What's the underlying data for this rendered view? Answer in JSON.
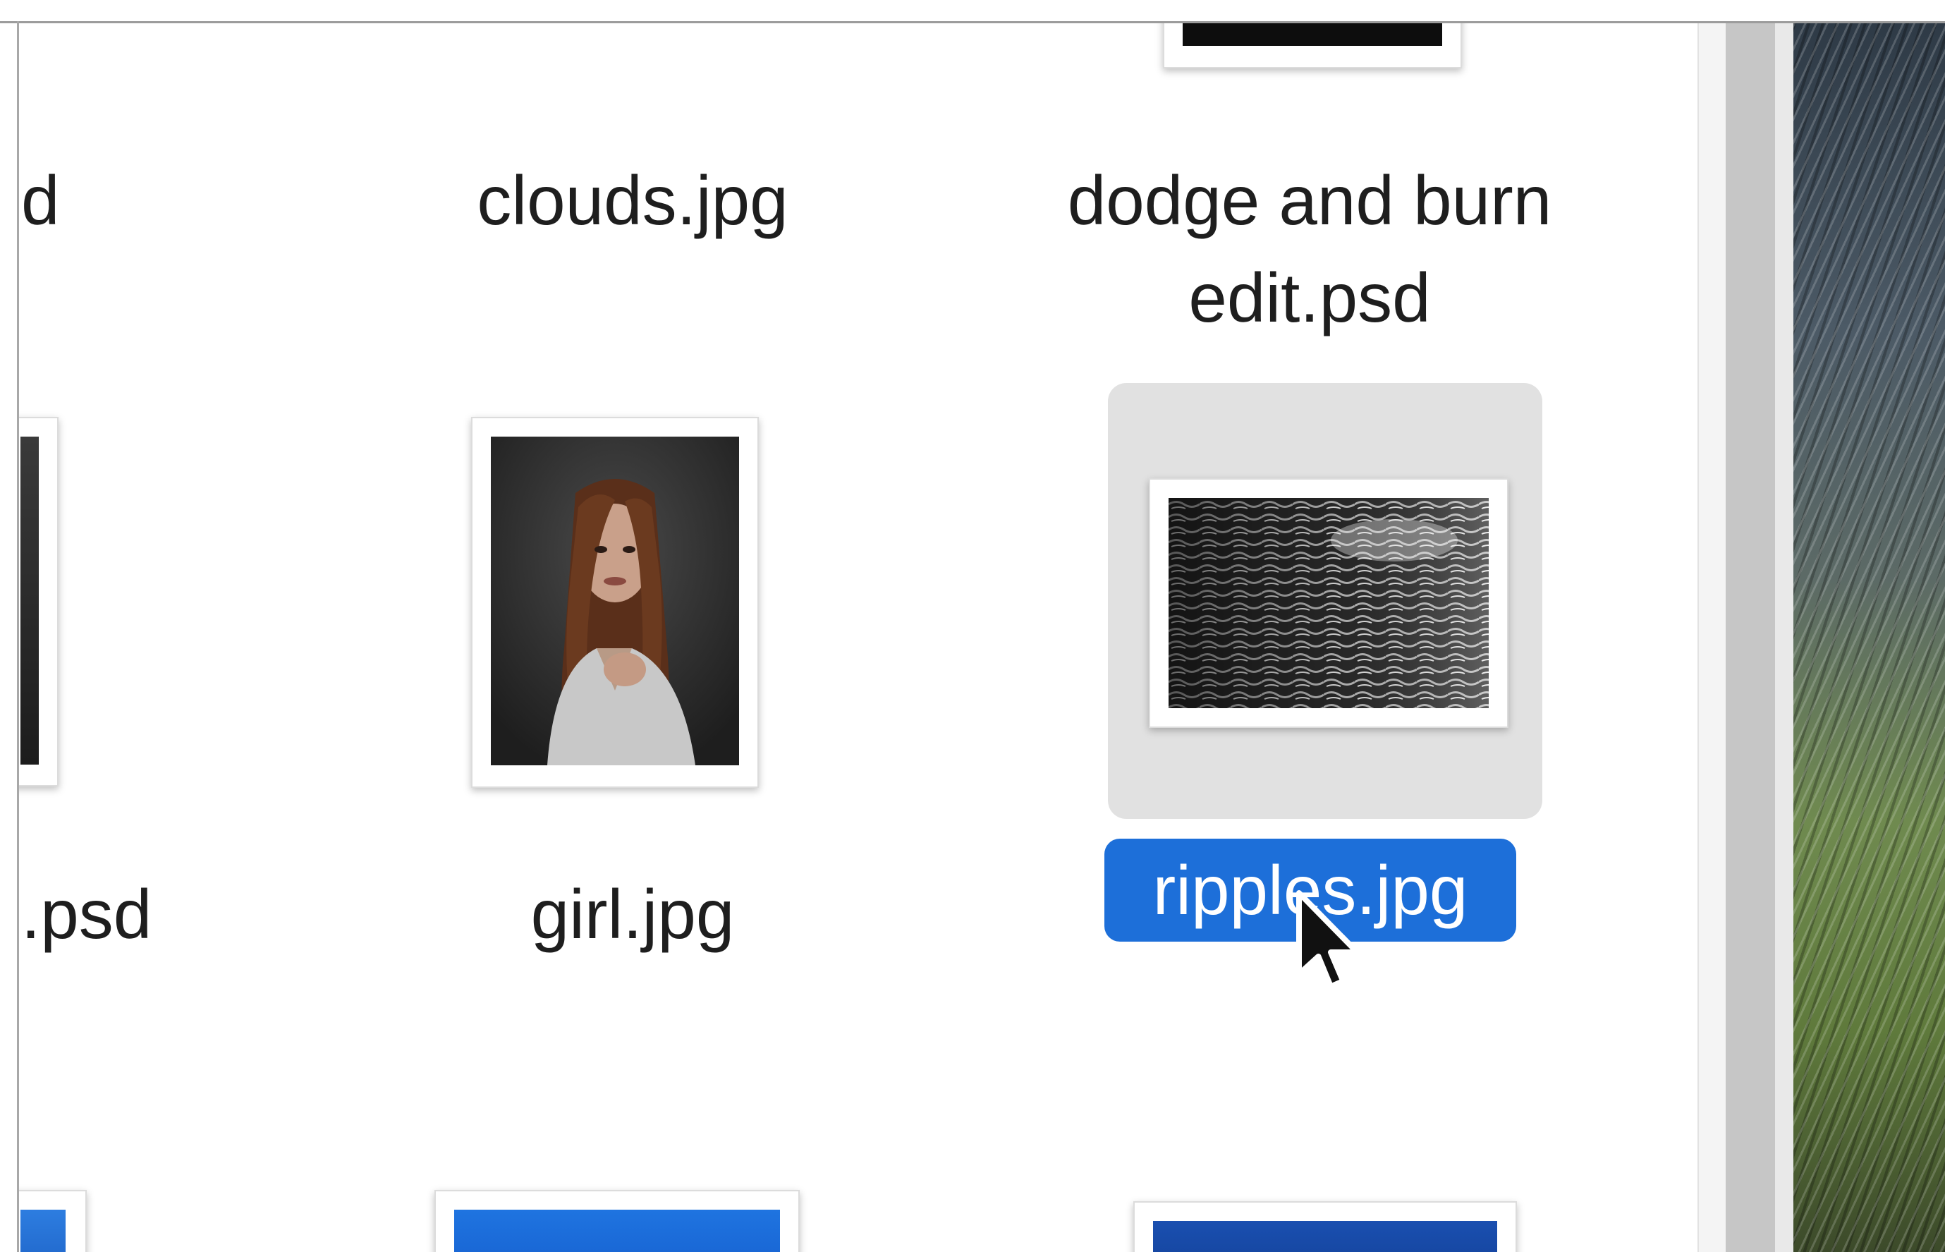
{
  "files": {
    "row1": {
      "partial_left_label": "d",
      "clouds_label": "clouds.jpg",
      "dodge_label_line1": "dodge and burn",
      "dodge_label_line2": "edit.psd"
    },
    "row2": {
      "partial_left_label": ".psd",
      "girl_label": "girl.jpg",
      "ripples_label": "ripples.jpg"
    }
  },
  "colors": {
    "selection_blue": "#1d6fd9",
    "selection_bg": "#e1e1e1",
    "window_bg": "#ffffff"
  },
  "icons": {
    "cursor": "arrow-pointer-icon"
  }
}
